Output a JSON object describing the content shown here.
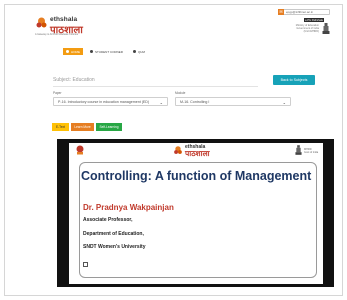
{
  "header": {
    "logo_english": "ethshala",
    "logo_hindi": "पाठशाला",
    "logo_tagline": "A Gateway to All Post Graduate Courses",
    "email": "epgp@inflibnet.ac.in",
    "black_button": "e-PG Pathshala",
    "ministry_lines": [
      "Ministry of Education",
      "Government of India",
      "(UGC/MHRD)"
    ]
  },
  "nav": {
    "items": [
      {
        "label": "HOME",
        "active": true
      },
      {
        "label": "STUDENT CORNER",
        "active": false
      },
      {
        "label": "QUIZ",
        "active": false
      }
    ]
  },
  "subject": {
    "label": "Subject: Education",
    "back_button": "Back to Subjects"
  },
  "paper": {
    "label": "Paper",
    "value": "P-16. Introductory course in education management (ED)"
  },
  "module": {
    "label": "Module",
    "value": "M-16. Controlling I"
  },
  "tabs": [
    {
      "label": "E-Text"
    },
    {
      "label": "Learn More"
    },
    {
      "label": "Self-Learning"
    }
  ],
  "slide": {
    "logo_english": "ethshala",
    "logo_hindi": "पाठशाला",
    "right_logo_text": [
      "MHRD",
      "Govt of India"
    ],
    "title": "Controlling: A function of Management",
    "author": "Dr. Pradnya Wakpainjan",
    "lines": [
      "Associate Professor,",
      "Department of Education,",
      "SNDT Women's University"
    ]
  },
  "colors": {
    "orange": "#f39c12",
    "teal": "#17a2b8",
    "yellow": "#ffc107",
    "green": "#28a745",
    "title_blue": "#1f3864",
    "name_red": "#c0392b"
  }
}
